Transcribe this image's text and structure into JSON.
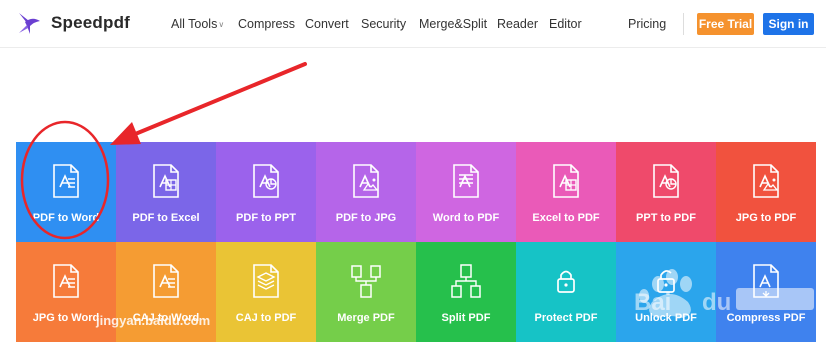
{
  "brand": {
    "name": "Speedpdf",
    "logo_color": "#6a3fd1"
  },
  "nav": {
    "items": [
      {
        "label": "All Tools",
        "has_caret": true
      },
      {
        "label": "Compress"
      },
      {
        "label": "Convert"
      },
      {
        "label": "Security"
      },
      {
        "label": "Merge&Split"
      },
      {
        "label": "Reader"
      },
      {
        "label": "Editor"
      },
      {
        "label": "Pricing"
      }
    ]
  },
  "actions": {
    "free_trial": "Free Trial",
    "sign_in": "Sign in"
  },
  "tools": [
    {
      "label": "PDF to Word",
      "color": "#2f8ff2",
      "icon": "pdf-to-word-icon"
    },
    {
      "label": "PDF to Excel",
      "color": "#7b66e8",
      "icon": "pdf-to-excel-icon"
    },
    {
      "label": "PDF to PPT",
      "color": "#9b62ec",
      "icon": "pdf-to-ppt-icon"
    },
    {
      "label": "PDF to JPG",
      "color": "#b565e9",
      "icon": "pdf-to-jpg-icon"
    },
    {
      "label": "Word to PDF",
      "color": "#cf66e1",
      "icon": "word-to-pdf-icon"
    },
    {
      "label": "Excel to PDF",
      "color": "#ea5ab8",
      "icon": "excel-to-pdf-icon"
    },
    {
      "label": "PPT to PDF",
      "color": "#ef4a6b",
      "icon": "ppt-to-pdf-icon"
    },
    {
      "label": "JPG to PDF",
      "color": "#f1523e",
      "icon": "jpg-to-pdf-icon"
    },
    {
      "label": "JPG to Word",
      "color": "#f67b3a",
      "icon": "jpg-to-word-icon"
    },
    {
      "label": "CAJ to Word",
      "color": "#f59c33",
      "icon": "caj-to-word-icon"
    },
    {
      "label": "CAJ to PDF",
      "color": "#eac435",
      "icon": "caj-to-pdf-icon"
    },
    {
      "label": "Merge PDF",
      "color": "#75ce4a",
      "icon": "merge-pdf-icon"
    },
    {
      "label": "Split PDF",
      "color": "#26c04c",
      "icon": "split-pdf-icon"
    },
    {
      "label": "Protect PDF",
      "color": "#16c3c6",
      "icon": "lock-icon"
    },
    {
      "label": "Unlock PDF",
      "color": "#2ba5ec",
      "icon": "unlock-icon"
    },
    {
      "label": "Compress PDF",
      "color": "#3f82ee",
      "icon": "compress-pdf-icon"
    }
  ],
  "annotation": {
    "color": "#e8262a"
  },
  "watermark": {
    "line": "jingyan.baidu.com"
  }
}
